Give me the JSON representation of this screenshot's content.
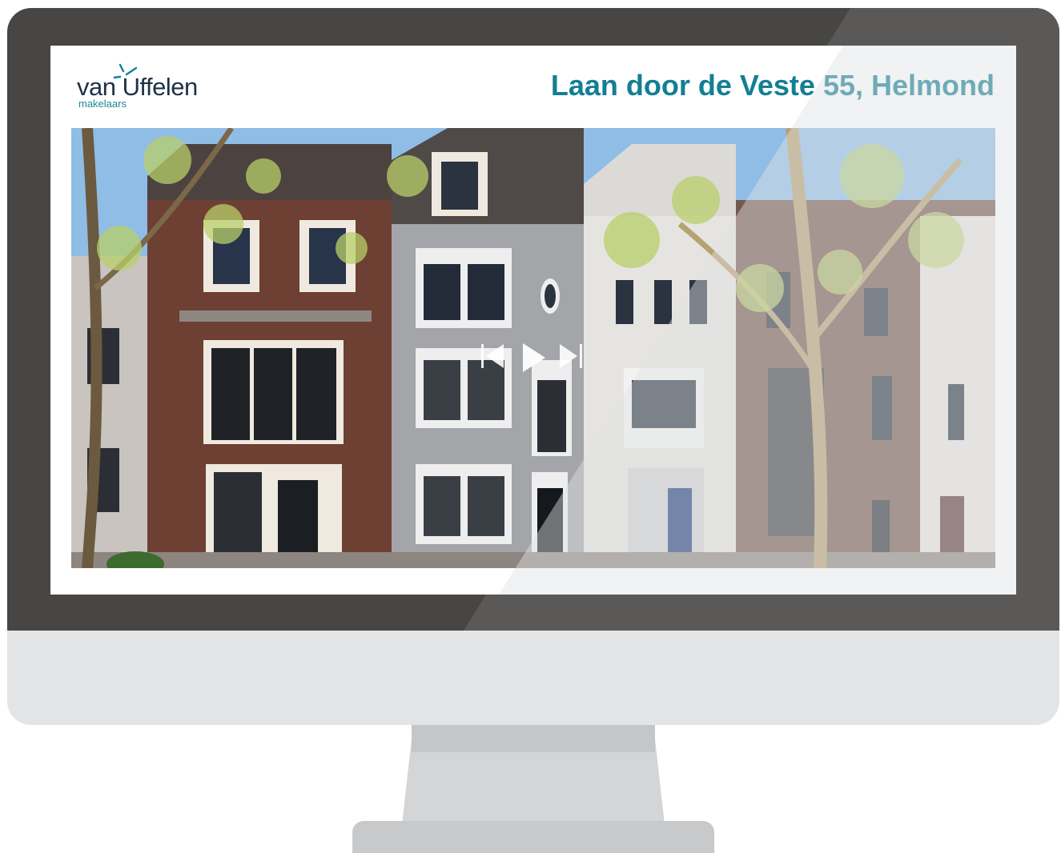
{
  "brand": {
    "name": "van Uffelen",
    "tagline": "makelaars",
    "accent_color": "#137f93",
    "dark_color": "#1e3246"
  },
  "listing": {
    "title": "Laan door de Veste 55, Helmond"
  },
  "photo": {
    "subject": "house-facade-photo"
  },
  "controls": {
    "previous_icon": "skip-previous-icon",
    "play_icon": "play-icon",
    "next_icon": "skip-next-icon"
  }
}
